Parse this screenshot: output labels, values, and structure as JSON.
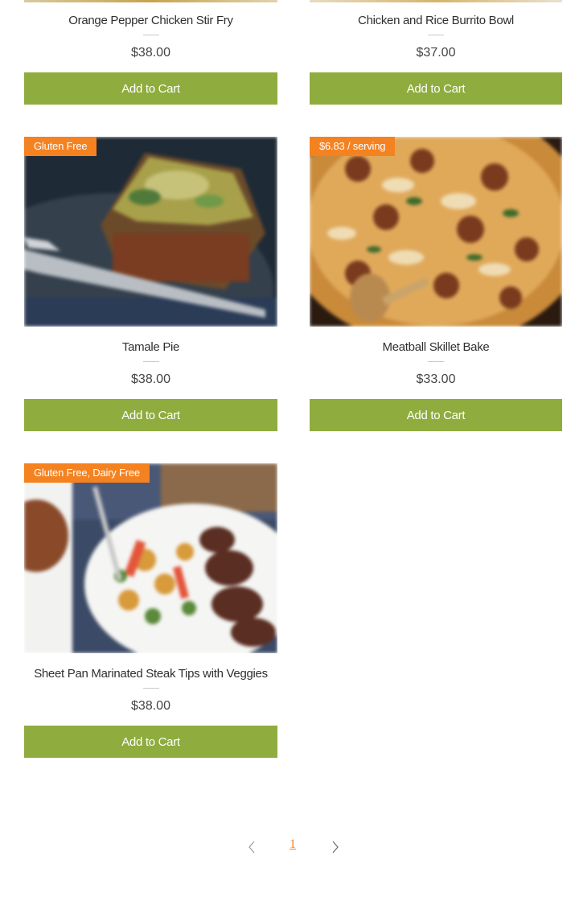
{
  "products": [
    {
      "name": "Orange Pepper Chicken Stir Fry",
      "price": "$38.00",
      "button": "Add to Cart",
      "ribbon": ""
    },
    {
      "name": "Chicken and Rice Burrito Bowl",
      "price": "$37.00",
      "button": "Add to Cart",
      "ribbon": ""
    },
    {
      "name": "Tamale Pie",
      "price": "$38.00",
      "button": "Add to Cart",
      "ribbon": "Gluten Free"
    },
    {
      "name": "Meatball Skillet Bake",
      "price": "$33.00",
      "button": "Add to Cart",
      "ribbon": "$6.83 / serving"
    },
    {
      "name": "Sheet Pan Marinated Steak Tips with Veggies",
      "price": "$38.00",
      "button": "Add to Cart",
      "ribbon": "Gluten Free, Dairy Free"
    }
  ],
  "pagination": {
    "current_page": "1",
    "prev_icon": "chevron-left-icon",
    "next_icon": "chevron-right-icon"
  },
  "colors": {
    "button": "#8fac3e",
    "ribbon": "#f58220",
    "page_active": "#f58220"
  }
}
